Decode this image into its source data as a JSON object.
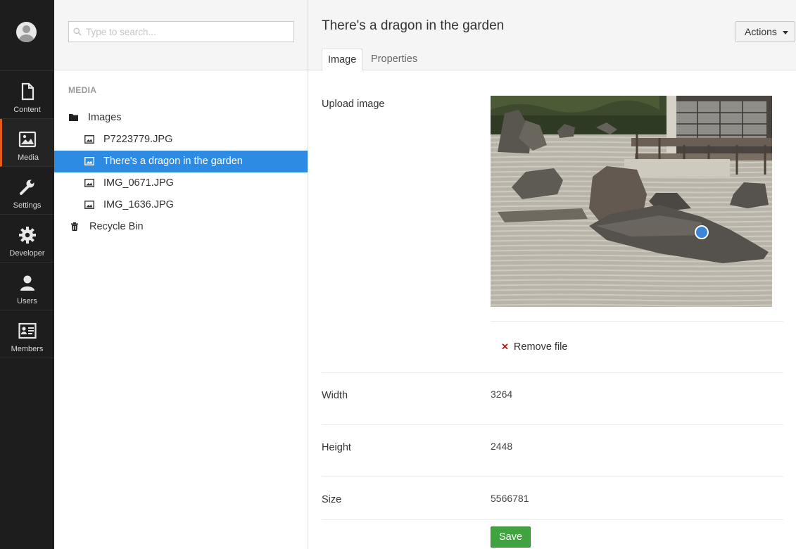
{
  "nav": {
    "items": [
      {
        "label": "Content",
        "icon": "document-icon",
        "active": false
      },
      {
        "label": "Media",
        "icon": "image-icon",
        "active": true
      },
      {
        "label": "Settings",
        "icon": "wrench-icon",
        "active": false
      },
      {
        "label": "Developer",
        "icon": "gear-icon",
        "active": false
      },
      {
        "label": "Users",
        "icon": "user-icon",
        "active": false
      },
      {
        "label": "Members",
        "icon": "id-card-icon",
        "active": false
      }
    ],
    "accent_color": "#e25a1c"
  },
  "tree": {
    "search_placeholder": "Type to search...",
    "section_title": "MEDIA",
    "items": [
      {
        "label": "Images",
        "icon": "folder-icon",
        "selected": false
      },
      {
        "label": "P7223779.JPG",
        "icon": "image-file-icon",
        "selected": false
      },
      {
        "label": "There's a dragon in the garden",
        "icon": "image-file-icon",
        "selected": true
      },
      {
        "label": "IMG_0671.JPG",
        "icon": "image-file-icon",
        "selected": false
      },
      {
        "label": "IMG_1636.JPG",
        "icon": "image-file-icon",
        "selected": false
      },
      {
        "label": "Recycle Bin",
        "icon": "trash-icon",
        "selected": false
      }
    ],
    "selected_color": "#2d8be4"
  },
  "editor": {
    "title": "There's a dragon in the garden",
    "actions_label": "Actions",
    "tabs": [
      {
        "label": "Image",
        "active": true
      },
      {
        "label": "Properties",
        "active": false
      }
    ],
    "upload_label": "Upload image",
    "remove_file_label": "Remove file",
    "properties": [
      {
        "label": "Width",
        "value": "3264"
      },
      {
        "label": "Height",
        "value": "2448"
      },
      {
        "label": "Size",
        "value": "5566781"
      }
    ],
    "save_label": "Save",
    "save_color": "#3fa33f"
  }
}
